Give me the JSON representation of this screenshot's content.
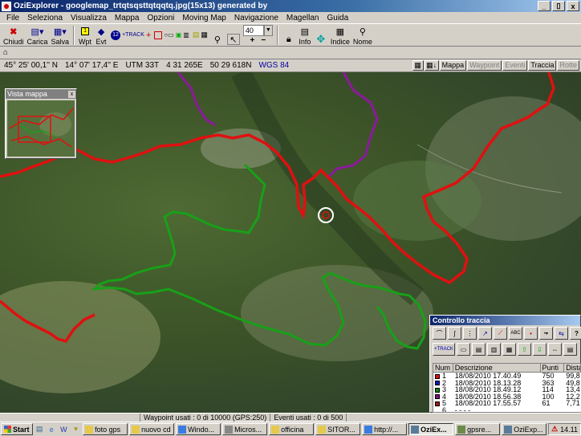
{
  "window": {
    "title": "OziExplorer - googlemap_trtqtsqsttqtqqtq.jpg(15x13) generated by",
    "minimize": "_",
    "maximize": "▯",
    "close": "x"
  },
  "menu": [
    "File",
    "Seleziona",
    "Visualizza",
    "Mappa",
    "Opzioni",
    "Moving Map",
    "Navigazione",
    "Magellan",
    "Guida"
  ],
  "toolbar": {
    "close_label": "Chiudi",
    "load_label": "Carica",
    "save_label": "Salva",
    "wpt_label": "Wpt",
    "evt_label": "Evt",
    "zoom_value": "40",
    "info_label": "Info",
    "index_label": "Indice",
    "name_label": "Nome"
  },
  "status": {
    "lat": "45° 25' 00,1'' N",
    "lon": "14° 07' 17,4'' E",
    "utm_zone": "UTM  33T",
    "easting": "4 31 265E",
    "northing": "50 29 618N",
    "datum": "WGS 84",
    "mode_buttons": [
      "Mappa",
      "Waypoint",
      "Eventi",
      "Traccia",
      "Rotte"
    ]
  },
  "minimap": {
    "title": "Vista mappa"
  },
  "track_panel": {
    "title": "Controllo traccia",
    "columns": [
      "Num",
      "Descrizione",
      "Punti",
      "Dista"
    ],
    "rows": [
      {
        "num": "1",
        "desc": "18/08/2010 17.40.49",
        "points": "750",
        "dist": "99,8",
        "color": "#e01010"
      },
      {
        "num": "2",
        "desc": "18/08/2010 18.13.28",
        "points": "363",
        "dist": "49,8",
        "color": "#1010c0"
      },
      {
        "num": "3",
        "desc": "18/08/2010 18.49.12",
        "points": "114",
        "dist": "13,4",
        "color": "#108010"
      },
      {
        "num": "4",
        "desc": "18/08/2010 18.56.38",
        "points": "100",
        "dist": "12,2",
        "color": "#801080"
      },
      {
        "num": "5",
        "desc": "18/08/2010 17.55.57",
        "points": "61",
        "dist": "7,71",
        "color": "#a01818"
      },
      {
        "num": "6",
        "desc": "- - - -",
        "points": "",
        "dist": "",
        "color": ""
      }
    ]
  },
  "map_status": {
    "waypoints": "Waypoint usati : 0 di 10000  (GPS:250)",
    "events": "Eventi usati : 0 di 500"
  },
  "taskbar": {
    "start": "Start",
    "tasks": [
      "foto gps",
      "nuovo cd",
      "Windo...",
      "Micros...",
      "officina",
      "SITOR...",
      "http://...",
      "OziEx...",
      "gpsre...",
      "OziExp..."
    ],
    "clock": "14.11"
  }
}
